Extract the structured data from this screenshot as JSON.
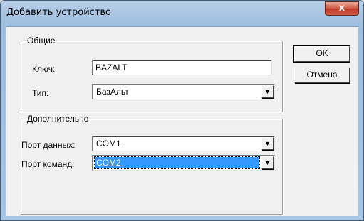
{
  "window": {
    "title": "Добавить устройство",
    "close_symbol": "x"
  },
  "general": {
    "legend": "Общие",
    "key_label": "Ключ:",
    "key_value": "BAZALT",
    "type_label": "Тип:",
    "type_value": "БазАльт"
  },
  "additional": {
    "legend": "Дополнительно",
    "data_port_label": "Порт данных:",
    "data_port_value": "COM1",
    "command_port_label": "Порт команд:",
    "command_port_value": "COM2"
  },
  "buttons": {
    "ok": "OK",
    "cancel": "Отмена"
  },
  "icons": {
    "dropdown": "▼"
  }
}
